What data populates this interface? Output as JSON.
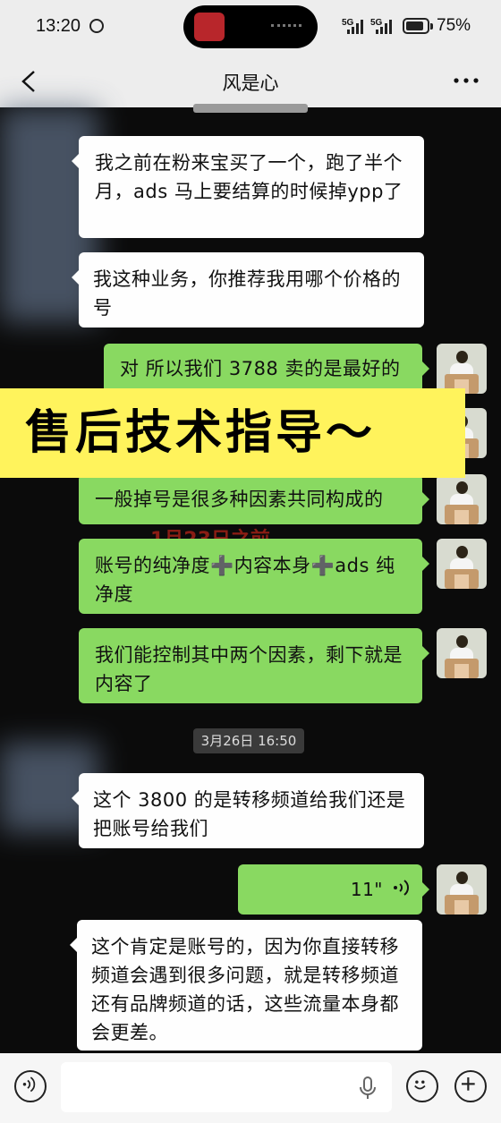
{
  "status_bar": {
    "time": "13:20",
    "net1": "5G",
    "net2": "5G",
    "battery": "75%"
  },
  "nav": {
    "title": "风是心"
  },
  "messages": [
    {
      "from": "them",
      "text": "我之前在粉来宝买了一个，跑了半个月，ads 马上要结算的时候掉ypp了"
    },
    {
      "from": "them",
      "text": "我这种业务，你推荐我用哪个价格的号"
    },
    {
      "from": "me",
      "text": "对 所以我们 3788 卖的是最好的"
    },
    {
      "from": "me",
      "text": "一般掉号是很多种因素共同构成的"
    },
    {
      "from": "me",
      "text": "账号的纯净度➕内容本身➕ads 纯净度"
    },
    {
      "from": "me",
      "text": "我们能控制其中两个因素，剩下就是内容了"
    },
    {
      "from": "them",
      "text": "这个 3800 的是转移频道给我们还是把账号给我们"
    },
    {
      "from": "me",
      "text": "11\""
    },
    {
      "from": "them",
      "text": "这个肯定是账号的，因为你直接转移频道会遇到很多问题，就是转移频道还有品牌频道的话，这些流量本身都会更差。"
    }
  ],
  "overlay": {
    "banner": "售后技术指导～",
    "partial_red_text": "1月23日之前"
  },
  "timestamp": "3月26日 16:50"
}
